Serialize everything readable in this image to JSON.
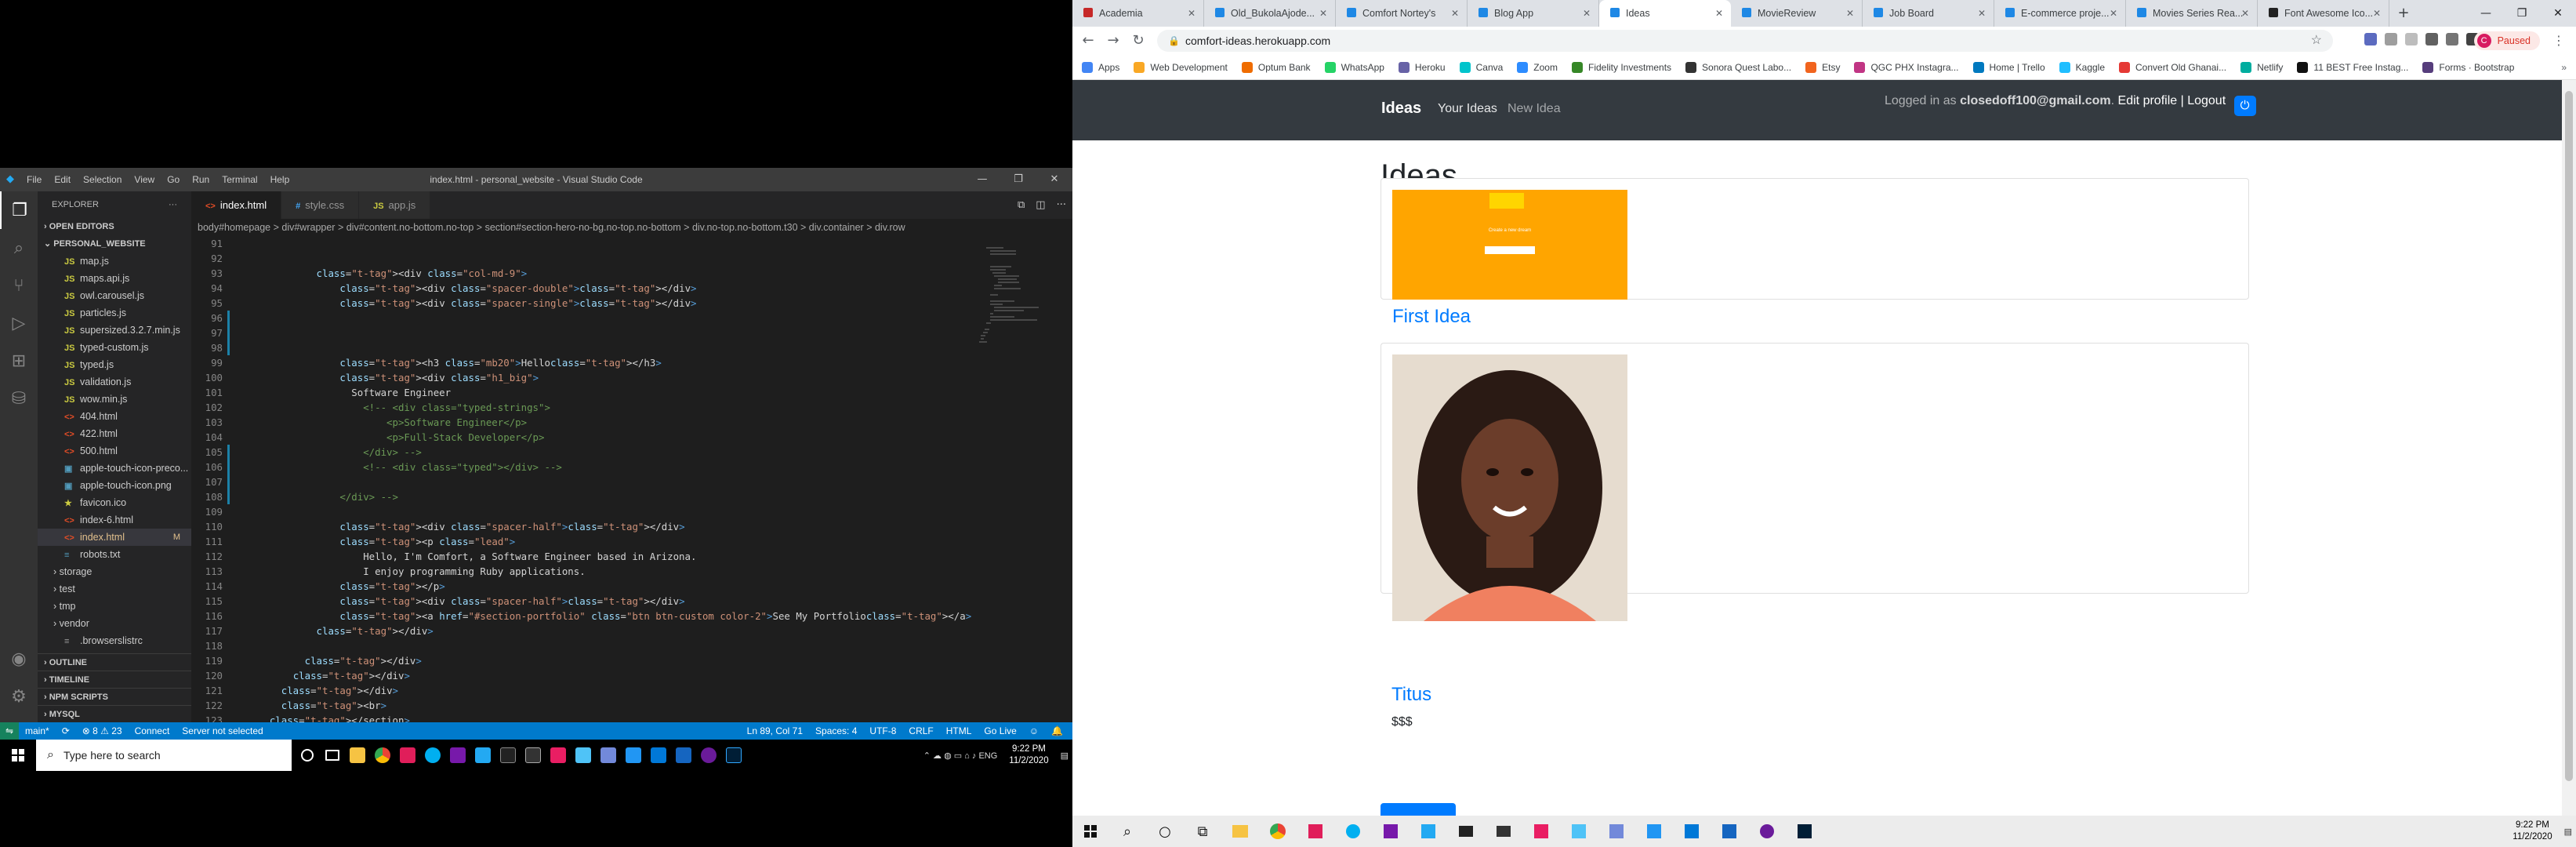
{
  "vscode": {
    "menu": [
      "File",
      "Edit",
      "Selection",
      "View",
      "Go",
      "Run",
      "Terminal",
      "Help"
    ],
    "title": "index.html - personal_website - Visual Studio Code",
    "explorer": {
      "header": "EXPLORER",
      "open_editors": "OPEN EDITORS",
      "project": "PERSONAL_WEBSITE",
      "files": [
        {
          "name": "map.js",
          "icon": "JS"
        },
        {
          "name": "maps.api.js",
          "icon": "JS"
        },
        {
          "name": "owl.carousel.js",
          "icon": "JS"
        },
        {
          "name": "particles.js",
          "icon": "JS"
        },
        {
          "name": "supersized.3.2.7.min.js",
          "icon": "JS"
        },
        {
          "name": "typed-custom.js",
          "icon": "JS"
        },
        {
          "name": "typed.js",
          "icon": "JS"
        },
        {
          "name": "validation.js",
          "icon": "JS"
        },
        {
          "name": "wow.min.js",
          "icon": "JS"
        },
        {
          "name": "404.html",
          "icon": "<>"
        },
        {
          "name": "422.html",
          "icon": "<>"
        },
        {
          "name": "500.html",
          "icon": "<>"
        },
        {
          "name": "apple-touch-icon-preco...",
          "icon": "▣"
        },
        {
          "name": "apple-touch-icon.png",
          "icon": "▣"
        },
        {
          "name": "favicon.ico",
          "icon": "★"
        },
        {
          "name": "index-6.html",
          "icon": "<>"
        },
        {
          "name": "index.html",
          "icon": "<>",
          "badge": "M"
        },
        {
          "name": "robots.txt",
          "icon": "≡"
        }
      ],
      "folders": [
        "storage",
        "test",
        "tmp",
        "vendor"
      ],
      "extra_file": ".browserslistrc",
      "bottom_sections": [
        "OUTLINE",
        "TIMELINE",
        "NPM SCRIPTS",
        "MYSQL"
      ]
    },
    "tabs": [
      {
        "label": "index.html",
        "icon": "<>",
        "color": "#e44d26"
      },
      {
        "label": "style.css",
        "icon": "#",
        "color": "#42a5f5"
      },
      {
        "label": "app.js",
        "icon": "JS",
        "color": "#cbcb41"
      }
    ],
    "breadcrumbs": "body#homepage  >  div#wrapper  >  div#content.no-bottom.no-top  >  section#section-hero-no-bg.no-top.no-bottom  >  div.no-top.no-bottom.t30  >  div.container  >  div.row",
    "code_lines": [
      {
        "n": "91",
        "t": ""
      },
      {
        "n": "92",
        "t": ""
      },
      {
        "n": "93",
        "t": "            <div class=\"col-md-9\">"
      },
      {
        "n": "94",
        "t": "                <div class=\"spacer-double\"></div>"
      },
      {
        "n": "95",
        "t": "                <div class=\"spacer-single\"></div>"
      },
      {
        "n": "96",
        "t": ""
      },
      {
        "n": "97",
        "t": ""
      },
      {
        "n": "98",
        "t": ""
      },
      {
        "n": "99",
        "t": "                <h3 class=\"mb20\">Hello</h3>"
      },
      {
        "n": "100",
        "t": "                <div class=\"h1_big\">"
      },
      {
        "n": "101",
        "t": "                  Software Engineer"
      },
      {
        "n": "102",
        "t": "                    <!-- <div class=\"typed-strings\">"
      },
      {
        "n": "103",
        "t": "                        <p>Software Engineer</p>"
      },
      {
        "n": "104",
        "t": "                        <p>Full-Stack Developer</p>"
      },
      {
        "n": "105",
        "t": "                    </div> -->"
      },
      {
        "n": "106",
        "t": "                    <!-- <div class=\"typed\"></div> -->"
      },
      {
        "n": "107",
        "t": ""
      },
      {
        "n": "108",
        "t": "                </div> -->"
      },
      {
        "n": "109",
        "t": ""
      },
      {
        "n": "110",
        "t": "                <div class=\"spacer-half\"></div>"
      },
      {
        "n": "111",
        "t": "                <p class=\"lead\">"
      },
      {
        "n": "112",
        "t": "                    Hello, I'm Comfort, a Software Engineer based in Arizona."
      },
      {
        "n": "113",
        "t": "                    I enjoy programming Ruby applications."
      },
      {
        "n": "114",
        "t": "                </p>"
      },
      {
        "n": "115",
        "t": "                <div class=\"spacer-half\"></div>"
      },
      {
        "n": "116",
        "t": "                <a href=\"#section-portfolio\" class=\"btn btn-custom color-2\">See My Portfolio</a>"
      },
      {
        "n": "117",
        "t": "            </div>"
      },
      {
        "n": "118",
        "t": ""
      },
      {
        "n": "119",
        "t": "          </div>"
      },
      {
        "n": "120",
        "t": "        </div>"
      },
      {
        "n": "121",
        "t": "      </div>"
      },
      {
        "n": "122",
        "t": "      <br>"
      },
      {
        "n": "123",
        "t": "    </section>"
      }
    ],
    "status": {
      "branch": "main*",
      "sync": "⟳",
      "problems": "⊗ 8 ⚠ 23",
      "connect": "Connect",
      "server": "Server not selected",
      "position": "Ln 89, Col 71",
      "spaces": "Spaces: 4",
      "encoding": "UTF-8",
      "eol": "CRLF",
      "language": "HTML",
      "golive": "Go Live"
    }
  },
  "taskbar_left": {
    "search_placeholder": "Type here to search",
    "time": "9:22 PM",
    "date": "11/2/2020"
  },
  "chrome": {
    "tabs": [
      {
        "label": "Academia",
        "color": "#c62828"
      },
      {
        "label": "Old_BukolaAjode...",
        "color": "#1e88e5"
      },
      {
        "label": "Comfort Nortey's",
        "color": "#1e88e5"
      },
      {
        "label": "Blog App",
        "color": "#1e88e5"
      },
      {
        "label": "Ideas",
        "color": "#1e88e5"
      },
      {
        "label": "MovieReview",
        "color": "#1e88e5"
      },
      {
        "label": "Job Board",
        "color": "#1e88e5"
      },
      {
        "label": "E-commerce proje...",
        "color": "#1e88e5"
      },
      {
        "label": "Movies Series Rea...",
        "color": "#1e88e5"
      },
      {
        "label": "Font Awesome Ico...",
        "color": "#222"
      }
    ],
    "url": "comfort-ideas.herokuapp.com",
    "profile_status": "Paused",
    "profile_initial": "C",
    "bookmarks": [
      {
        "label": "Apps",
        "color": "#4285f4"
      },
      {
        "label": "Web Development",
        "color": "#f9a825"
      },
      {
        "label": "Optum Bank",
        "color": "#ef6c00"
      },
      {
        "label": "WhatsApp",
        "color": "#25d366"
      },
      {
        "label": "Heroku",
        "color": "#6762a6"
      },
      {
        "label": "Canva",
        "color": "#00c4cc"
      },
      {
        "label": "Zoom",
        "color": "#2d8cff"
      },
      {
        "label": "Fidelity Investments",
        "color": "#368727"
      },
      {
        "label": "Sonora Quest Labo...",
        "color": "#333"
      },
      {
        "label": "Etsy",
        "color": "#f1641e"
      },
      {
        "label": "QGC PHX Instagra...",
        "color": "#c13584"
      },
      {
        "label": "Home | Trello",
        "color": "#0079bf"
      },
      {
        "label": "Kaggle",
        "color": "#20beff"
      },
      {
        "label": "Convert Old Ghanai...",
        "color": "#e53935"
      },
      {
        "label": "Netlify",
        "color": "#00ad9f"
      },
      {
        "label": "11 BEST Free Instag...",
        "color": "#111"
      },
      {
        "label": "Forms · Bootstrap",
        "color": "#563d7c"
      }
    ]
  },
  "site": {
    "brand": "Ideas",
    "nav_your_ideas": "Your Ideas",
    "nav_new_idea": "New Idea",
    "logged_in_prefix": "Logged in as",
    "user_email": "closedoff100@gmail.com",
    "edit_profile": "Edit profile",
    "separator": "|",
    "logout": "Logout",
    "heading": "Ideas",
    "ideas": [
      {
        "title": "First Idea",
        "text": ""
      },
      {
        "title": "Titus",
        "text": "$$$"
      }
    ],
    "thumb": {
      "title": "Create a new dream",
      "colors": {
        "bg": "#ffa500",
        "box": "#ffd500"
      }
    }
  },
  "taskbar_right": {
    "time": "9:22 PM",
    "date": "11/2/2020"
  }
}
